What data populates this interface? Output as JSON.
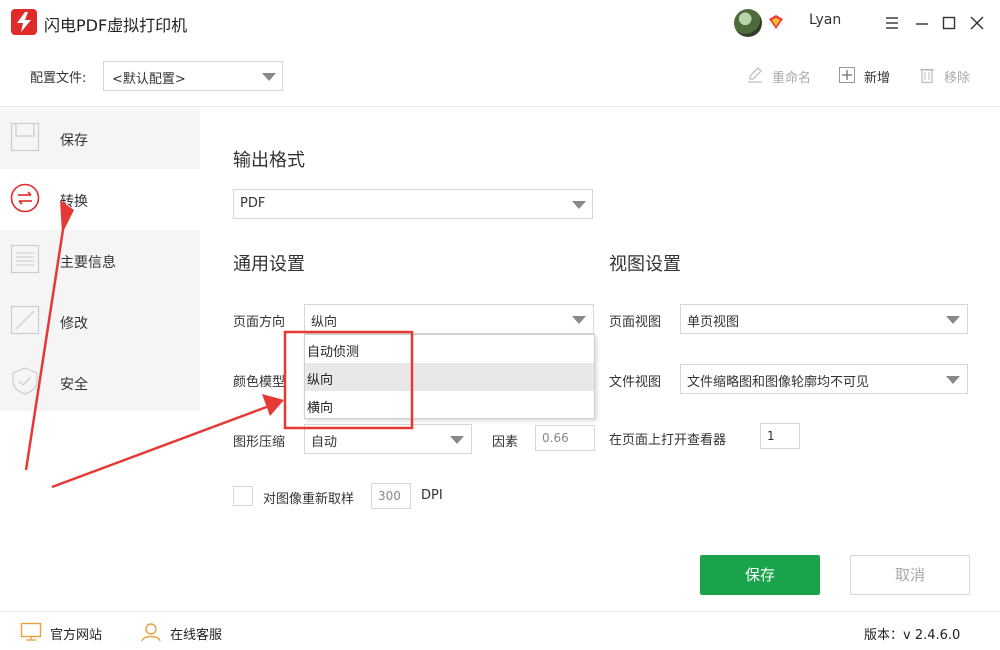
{
  "app": {
    "title": "闪电PDF虚拟打印机",
    "brand_color": "#e02b2b",
    "accent_color": "#1aa34a"
  },
  "user": {
    "name": "Lyan"
  },
  "config": {
    "label": "配置文件:",
    "selected": "<默认配置>",
    "rename_label": "重命名",
    "new_label": "新增",
    "remove_label": "移除"
  },
  "sidebar": {
    "items": [
      {
        "label": "保存",
        "icon": "save-icon"
      },
      {
        "label": "转换",
        "icon": "convert-icon"
      },
      {
        "label": "主要信息",
        "icon": "info-icon"
      },
      {
        "label": "修改",
        "icon": "edit-icon"
      },
      {
        "label": "安全",
        "icon": "shield-icon"
      }
    ]
  },
  "output": {
    "title": "输出格式",
    "format": "PDF"
  },
  "general": {
    "title": "通用设置",
    "orientation_label": "页面方向",
    "orientation_value": "纵向",
    "color_label": "颜色模型",
    "compression_label": "图形压缩",
    "compression_value": "自动",
    "factor_label": "因素",
    "factor_value": "0.66",
    "resample_label": "对图像重新取样",
    "resample_value": "300",
    "dpi_label": "DPI"
  },
  "orientation_dropdown": {
    "options": [
      "自动侦测",
      "纵向",
      "横向"
    ],
    "hovered_index": 1
  },
  "view": {
    "title": "视图设置",
    "page_view_label": "页面视图",
    "page_view_value": "单页视图",
    "doc_view_label": "文件视图",
    "doc_view_value": "文件缩略图和图像轮廓均不可见",
    "open_viewer_label": "在页面上打开查看器",
    "open_viewer_value": "1"
  },
  "actions": {
    "save_label": "保存",
    "cancel_label": "取消"
  },
  "footer": {
    "website_label": "官方网站",
    "support_label": "在线客服",
    "version_label": "版本：",
    "version_value": "v 2.4.6.0"
  }
}
